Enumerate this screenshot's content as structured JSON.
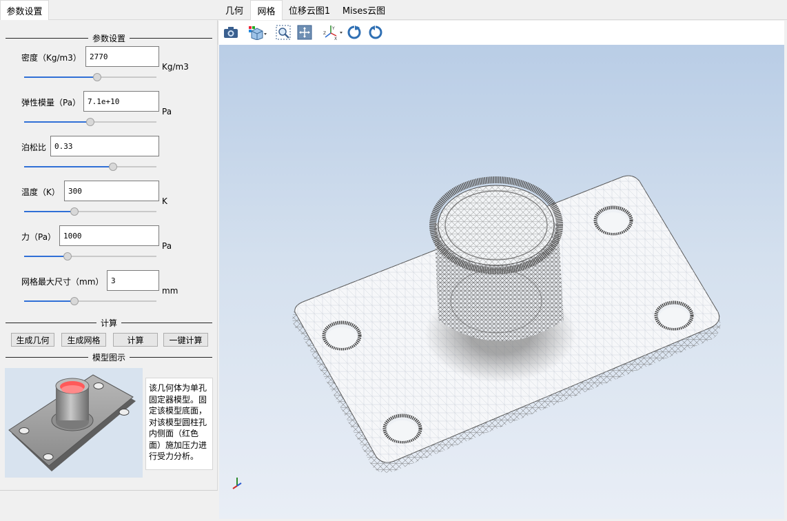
{
  "left_tab": {
    "label": "参数设置"
  },
  "params_group": {
    "title": "参数设置"
  },
  "fields": [
    {
      "label": "密度（Kg/m3）",
      "value": "2770",
      "unit": "Kg/m3",
      "slider_fraction": 0.55
    },
    {
      "label": "弹性模量（Pa）",
      "value": "7.1e+10",
      "unit": "Pa",
      "slider_fraction": 0.5
    },
    {
      "label": "泊松比",
      "value": "0.33",
      "unit": "",
      "slider_fraction": 0.67
    },
    {
      "label": "温度（K）",
      "value": "300",
      "unit": "K",
      "slider_fraction": 0.38
    },
    {
      "label": "力（Pa）",
      "value": "1000",
      "unit": "Pa",
      "slider_fraction": 0.33
    },
    {
      "label": "网格最大尺寸（mm）",
      "value": "3",
      "unit": "mm",
      "slider_fraction": 0.38
    }
  ],
  "compute_group": {
    "title": "计算"
  },
  "buttons": {
    "gen_geometry": "生成几何",
    "gen_mesh": "生成网格",
    "compute": "计算",
    "one_click": "一键计算"
  },
  "model_group": {
    "title": "模型图示"
  },
  "model_description": "该几何体为单孔固定器模型。固定该模型底面，对该模型圆柱孔内侧面（红色面）施加压力进行受力分析。",
  "tabs": [
    {
      "label": "几何",
      "active": false
    },
    {
      "label": "网格",
      "active": true
    },
    {
      "label": "位移云图1",
      "active": false
    },
    {
      "label": "Mises云图",
      "active": false
    }
  ],
  "toolbar_icons": [
    "camera-icon",
    "view-cube-icon",
    "zoom-window-icon",
    "fit-all-icon",
    "axis-orientation-icon",
    "rotate-cw-icon",
    "rotate-ccw-icon"
  ],
  "colors": {
    "accent": "#2f6fd6",
    "viewport_top": "#b9cde6",
    "viewport_bottom": "#e9eef6",
    "highlight_face": "#ff5a5a"
  }
}
